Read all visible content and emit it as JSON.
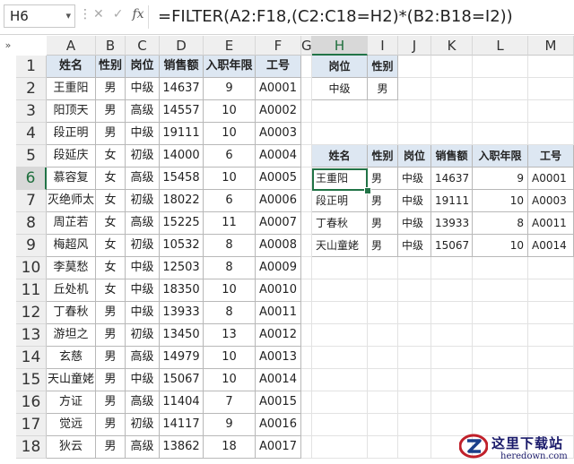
{
  "formula_bar": {
    "name_box": "H6",
    "formula": "=FILTER(A2:F18,(C2:C18=H2)*(B2:B18=I2))"
  },
  "corner_label": "»",
  "columns": [
    "A",
    "B",
    "C",
    "D",
    "E",
    "F",
    "G",
    "H",
    "I",
    "J",
    "K",
    "L",
    "M"
  ],
  "rows": [
    "1",
    "2",
    "3",
    "4",
    "5",
    "6",
    "7",
    "8",
    "9",
    "10",
    "11",
    "12",
    "13",
    "14",
    "15",
    "16",
    "17",
    "18"
  ],
  "selected_cell": {
    "col": "H",
    "row": "6"
  },
  "source_table": {
    "headers": [
      "姓名",
      "性别",
      "岗位",
      "销售额",
      "入职年限",
      "工号"
    ],
    "rows": [
      [
        "王重阳",
        "男",
        "中级",
        "14637",
        "9",
        "A0001"
      ],
      [
        "阳顶天",
        "男",
        "高级",
        "14557",
        "10",
        "A0002"
      ],
      [
        "段正明",
        "男",
        "中级",
        "19111",
        "10",
        "A0003"
      ],
      [
        "段延庆",
        "女",
        "初级",
        "14000",
        "6",
        "A0004"
      ],
      [
        "慕容复",
        "女",
        "高级",
        "15458",
        "10",
        "A0005"
      ],
      [
        "灭绝师太",
        "女",
        "初级",
        "18022",
        "6",
        "A0006"
      ],
      [
        "周芷若",
        "女",
        "高级",
        "15225",
        "11",
        "A0007"
      ],
      [
        "梅超风",
        "女",
        "初级",
        "10532",
        "8",
        "A0008"
      ],
      [
        "李莫愁",
        "女",
        "中级",
        "12503",
        "8",
        "A0009"
      ],
      [
        "丘处机",
        "女",
        "中级",
        "18350",
        "10",
        "A0010"
      ],
      [
        "丁春秋",
        "男",
        "中级",
        "13933",
        "8",
        "A0011"
      ],
      [
        "游坦之",
        "男",
        "初级",
        "13450",
        "13",
        "A0012"
      ],
      [
        "玄慈",
        "男",
        "高级",
        "14979",
        "10",
        "A0013"
      ],
      [
        "天山童姥",
        "男",
        "中级",
        "15067",
        "10",
        "A0014"
      ],
      [
        "方证",
        "男",
        "高级",
        "11404",
        "7",
        "A0015"
      ],
      [
        "觉远",
        "男",
        "初级",
        "14117",
        "9",
        "A0016"
      ],
      [
        "狄云",
        "男",
        "高级",
        "13862",
        "18",
        "A0017"
      ]
    ]
  },
  "criteria": {
    "headers": [
      "岗位",
      "性别"
    ],
    "values": [
      "中级",
      "男"
    ]
  },
  "result_table": {
    "headers": [
      "姓名",
      "性别",
      "岗位",
      "销售额",
      "入职年限",
      "工号"
    ],
    "rows": [
      [
        "王重阳",
        "男",
        "中级",
        "14637",
        "9",
        "A0001"
      ],
      [
        "段正明",
        "男",
        "中级",
        "19111",
        "10",
        "A0003"
      ],
      [
        "丁春秋",
        "男",
        "中级",
        "13933",
        "8",
        "A0011"
      ],
      [
        "天山童姥",
        "男",
        "中级",
        "15067",
        "10",
        "A0014"
      ]
    ]
  },
  "watermark": {
    "cn": "这里下载站",
    "en": "heredown.com"
  }
}
